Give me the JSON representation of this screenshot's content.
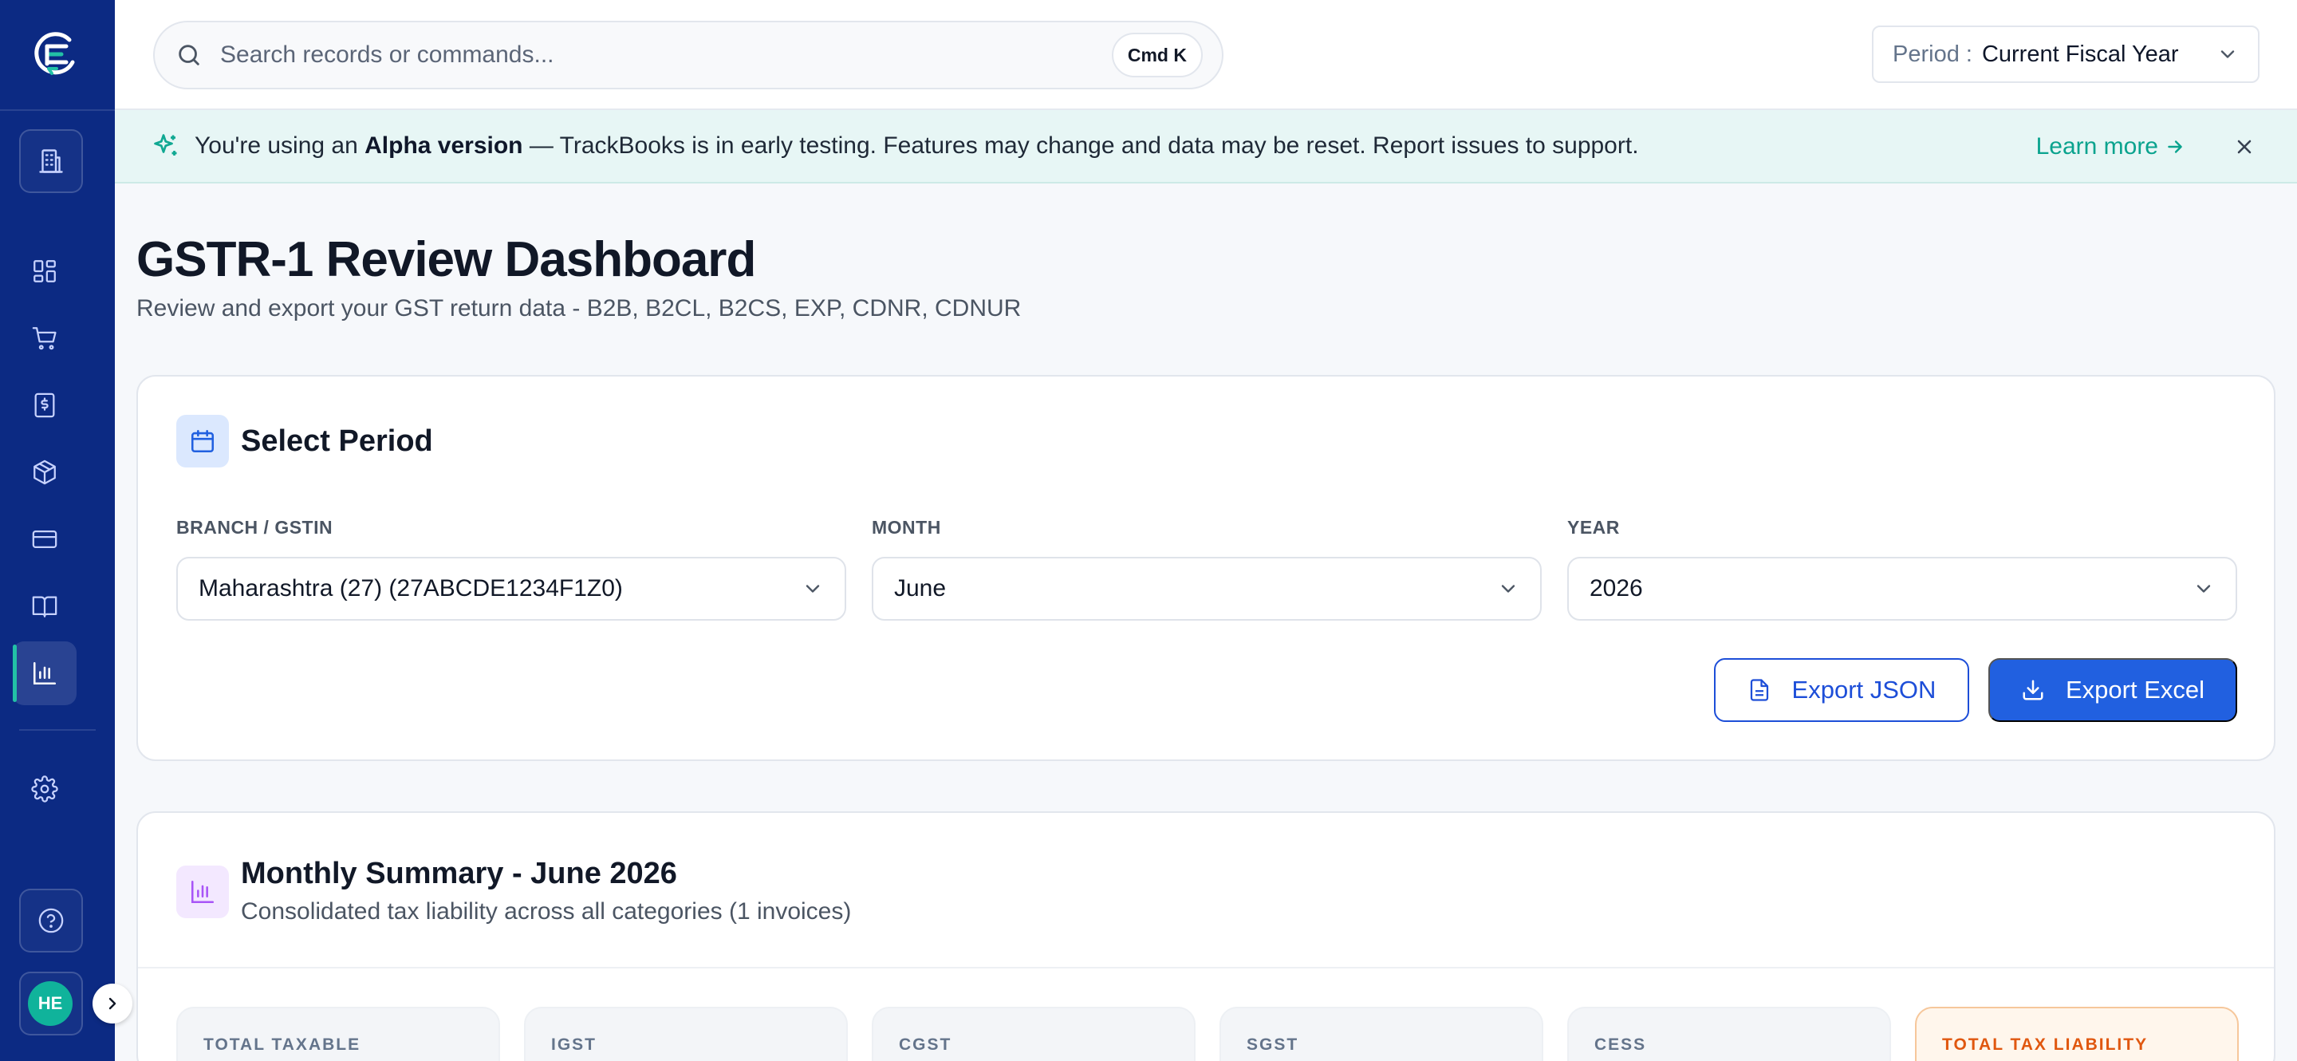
{
  "search": {
    "placeholder": "Search records or commands...",
    "shortcut": "Cmd K"
  },
  "period": {
    "label": "Period :",
    "value": "Current Fiscal Year"
  },
  "banner": {
    "prefix": "You're using an ",
    "highlight": "Alpha version",
    "suffix": " — TrackBooks is in early testing. Features may change and data may be reset. Report issues to support.",
    "link": "Learn more"
  },
  "page": {
    "title": "GSTR-1 Review Dashboard",
    "subtitle": "Review and export your GST return data - B2B, B2CL, B2CS, EXP, CDNR, CDNUR"
  },
  "select_period": {
    "title": "Select Period",
    "branch_label": "BRANCH / GSTIN",
    "branch_value": "Maharashtra (27) (27ABCDE1234F1Z0)",
    "month_label": "MONTH",
    "month_value": "June",
    "year_label": "YEAR",
    "year_value": "2026",
    "export_json": "Export JSON",
    "export_excel": "Export Excel"
  },
  "summary": {
    "title": "Monthly Summary - June 2026",
    "subtitle": "Consolidated tax liability across all categories (1 invoices)",
    "metrics": [
      "TOTAL TAXABLE",
      "IGST",
      "CGST",
      "SGST",
      "CESS",
      "TOTAL TAX LIABILITY"
    ]
  },
  "user": {
    "initials": "HE"
  },
  "icons": {
    "sidebar": [
      "building-icon",
      "dashboard-icon",
      "cart-icon",
      "invoice-icon",
      "package-icon",
      "credit-card-icon",
      "book-icon",
      "bar-chart-icon",
      "settings-icon",
      "help-icon"
    ]
  },
  "colors": {
    "sidebar_bg": "#0c2a83",
    "accent_teal": "#10b39b",
    "primary_blue": "#2160e0",
    "banner_bg": "#e7f6f5",
    "warning_orange": "#e0570f"
  }
}
